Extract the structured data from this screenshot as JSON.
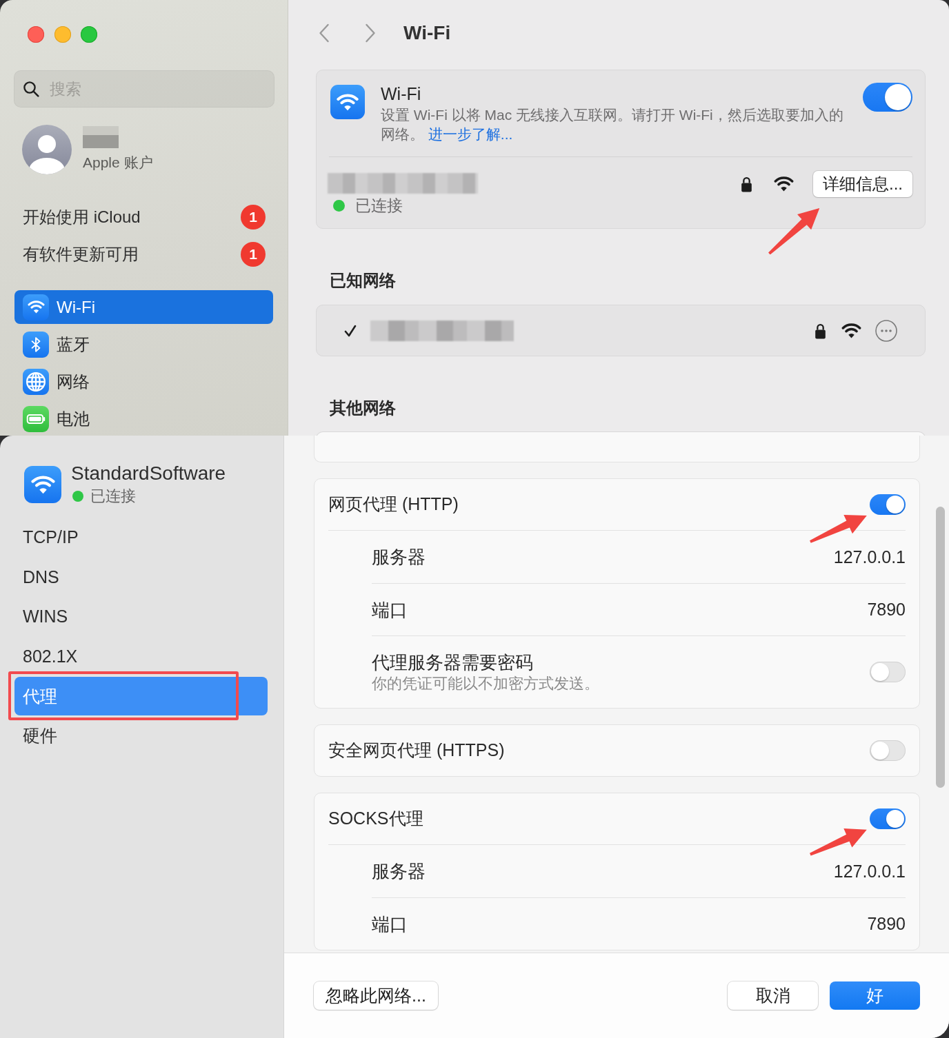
{
  "settings_window": {
    "sidebar": {
      "search": {
        "placeholder": "搜索"
      },
      "account": {
        "subtitle": "Apple 账户"
      },
      "alerts": [
        {
          "label": "开始使用 iCloud",
          "badge": "1"
        },
        {
          "label": "有软件更新可用",
          "badge": "1"
        }
      ],
      "items": [
        {
          "kind": "wifi",
          "label": "Wi-Fi",
          "selected": true
        },
        {
          "kind": "bluetooth",
          "label": "蓝牙",
          "selected": false
        },
        {
          "kind": "network",
          "label": "网络",
          "selected": false
        },
        {
          "kind": "battery",
          "label": "电池",
          "selected": false
        }
      ]
    },
    "toolbar": {
      "title": "Wi-Fi"
    },
    "wifi_card": {
      "title": "Wi-Fi",
      "description": "设置 Wi-Fi 以将 Mac 无线接入互联网。请打开 Wi-Fi，然后选取要加入的网络。",
      "link": "进一步了解...",
      "on": true,
      "current_network": {
        "status": "已连接",
        "details_button": {
          "label": "详细信息...",
          "annotated": true
        }
      }
    },
    "known_networks": {
      "heading": "已知网络",
      "networks": [
        {
          "checked": true
        }
      ]
    },
    "other_networks": {
      "heading": "其他网络"
    }
  },
  "network_sheet": {
    "header": {
      "name": "StandardSoftware",
      "status": "已连接"
    },
    "sidebar": {
      "items": [
        {
          "label": "TCP/IP",
          "selected": false,
          "highlighted": false
        },
        {
          "label": "DNS",
          "selected": false,
          "highlighted": false
        },
        {
          "label": "WINS",
          "selected": false,
          "highlighted": false
        },
        {
          "label": "802.1X",
          "selected": false,
          "highlighted": false
        },
        {
          "label": "代理",
          "selected": true,
          "highlighted": true
        },
        {
          "label": "硬件",
          "selected": false,
          "highlighted": false
        }
      ]
    },
    "proxy_sections": [
      {
        "title": "网页代理 (HTTP)",
        "on": true,
        "annotated": true,
        "fields": [
          {
            "kind": "value",
            "label": "服务器",
            "value": "127.0.0.1"
          },
          {
            "kind": "value",
            "label": "端口",
            "value": "7890"
          },
          {
            "kind": "switch",
            "label": "代理服务器需要密码",
            "note": "你的凭证可能以不加密方式发送。",
            "on": false
          }
        ]
      },
      {
        "title": "安全网页代理 (HTTPS)",
        "on": false,
        "annotated": false
      },
      {
        "title": "SOCKS代理",
        "on": true,
        "annotated": true,
        "fields": [
          {
            "kind": "value",
            "label": "服务器",
            "value": "127.0.0.1"
          },
          {
            "kind": "value",
            "label": "端口",
            "value": "7890"
          }
        ]
      }
    ],
    "buttons": [
      {
        "label": "忽略此网络...",
        "kind": "secondary"
      },
      {
        "label": "取消",
        "kind": "secondary"
      },
      {
        "label": "好",
        "kind": "primary"
      }
    ]
  }
}
